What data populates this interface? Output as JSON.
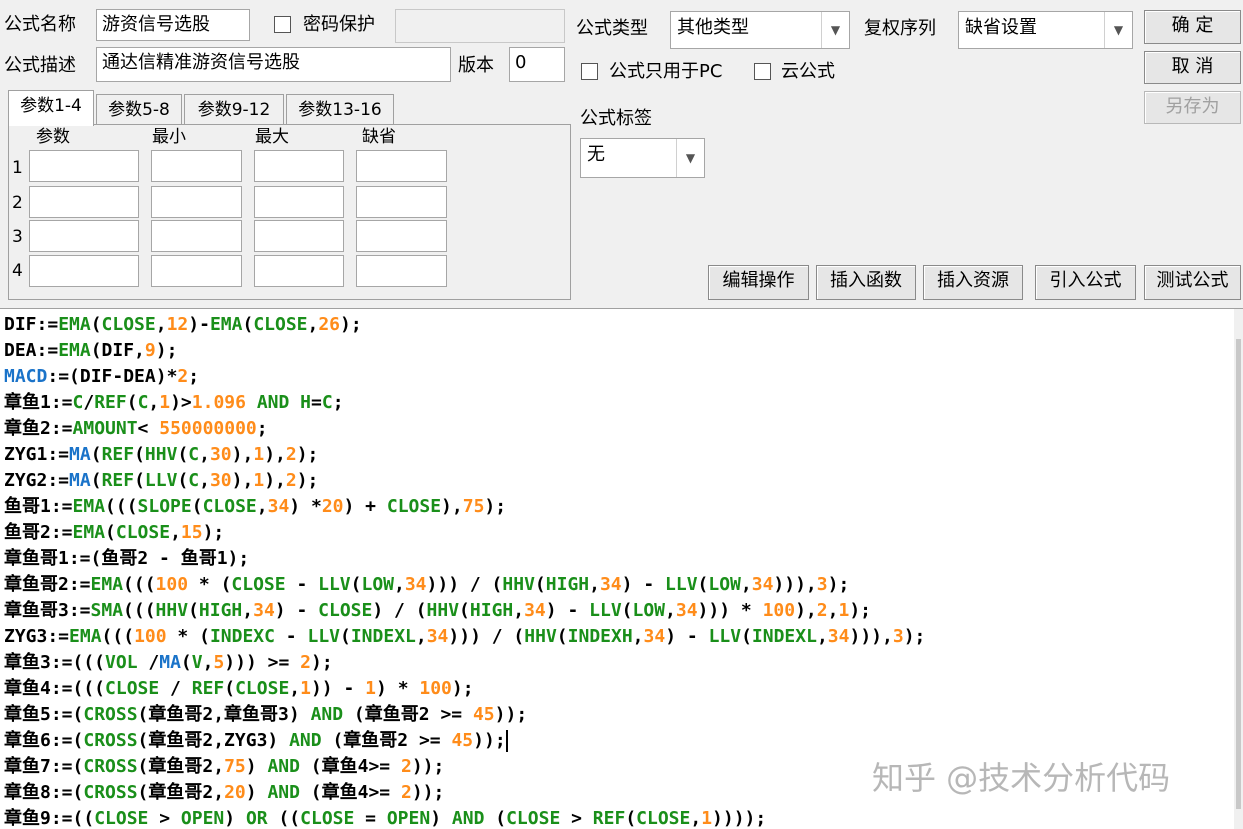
{
  "header": {
    "name_label": "公式名称",
    "name_value": "游资信号选股",
    "password_label": "密码保护",
    "password_checked": false,
    "desc_label": "公式描述",
    "desc_value": "通达信精准游资信号选股",
    "version_label": "版本",
    "version_value": "0",
    "type_label": "公式类型",
    "type_value": "其他类型",
    "rights_label": "复权序列",
    "rights_value": "缺省设置",
    "pc_only_label": "公式只用于PC",
    "cloud_label": "云公式",
    "tag_label": "公式标签",
    "tag_value": "无"
  },
  "buttons": {
    "ok": "确  定",
    "cancel": "取  消",
    "save_as": "另存为",
    "edit_ops": "编辑操作",
    "insert_func": "插入函数",
    "insert_res": "插入资源",
    "import_formula": "引入公式",
    "test_formula": "测试公式"
  },
  "tabs": [
    "参数1-4",
    "参数5-8",
    "参数9-12",
    "参数13-16"
  ],
  "params": {
    "headers": [
      "参数",
      "最小",
      "最大",
      "缺省"
    ],
    "rows": [
      "1",
      "2",
      "3",
      "4"
    ]
  },
  "code_lines": [
    [
      [
        "t",
        "DIF:="
      ],
      [
        "f",
        "EMA"
      ],
      [
        "t",
        "("
      ],
      [
        "f",
        "CLOSE"
      ],
      [
        "t",
        ","
      ],
      [
        "n",
        "12"
      ],
      [
        "t",
        ")-"
      ],
      [
        "f",
        "EMA"
      ],
      [
        "t",
        "("
      ],
      [
        "f",
        "CLOSE"
      ],
      [
        "t",
        ","
      ],
      [
        "n",
        "26"
      ],
      [
        "t",
        ");"
      ]
    ],
    [
      [
        "t",
        "DEA:="
      ],
      [
        "f",
        "EMA"
      ],
      [
        "t",
        "(DIF,"
      ],
      [
        "n",
        "9"
      ],
      [
        "t",
        ");"
      ]
    ],
    [
      [
        "b",
        "MACD"
      ],
      [
        "t",
        ":=(DIF-DEA)*"
      ],
      [
        "n",
        "2"
      ],
      [
        "t",
        ";"
      ]
    ],
    [
      [
        "t",
        "章鱼1:="
      ],
      [
        "f",
        "C"
      ],
      [
        "t",
        "/"
      ],
      [
        "f",
        "REF"
      ],
      [
        "t",
        "("
      ],
      [
        "f",
        "C"
      ],
      [
        "t",
        ","
      ],
      [
        "n",
        "1"
      ],
      [
        "t",
        ")>"
      ],
      [
        "n",
        "1.096"
      ],
      [
        "t",
        " "
      ],
      [
        "f",
        "AND"
      ],
      [
        "t",
        " "
      ],
      [
        "f",
        "H"
      ],
      [
        "t",
        "="
      ],
      [
        "f",
        "C"
      ],
      [
        "t",
        ";"
      ]
    ],
    [
      [
        "t",
        "章鱼2:="
      ],
      [
        "f",
        "AMOUNT"
      ],
      [
        "t",
        "< "
      ],
      [
        "n",
        "550000000"
      ],
      [
        "t",
        ";"
      ]
    ],
    [
      [
        "t",
        "ZYG1:="
      ],
      [
        "b",
        "MA"
      ],
      [
        "t",
        "("
      ],
      [
        "f",
        "REF"
      ],
      [
        "t",
        "("
      ],
      [
        "f",
        "HHV"
      ],
      [
        "t",
        "("
      ],
      [
        "f",
        "C"
      ],
      [
        "t",
        ","
      ],
      [
        "n",
        "30"
      ],
      [
        "t",
        "),"
      ],
      [
        "n",
        "1"
      ],
      [
        "t",
        "),"
      ],
      [
        "n",
        "2"
      ],
      [
        "t",
        ");"
      ]
    ],
    [
      [
        "t",
        "ZYG2:="
      ],
      [
        "b",
        "MA"
      ],
      [
        "t",
        "("
      ],
      [
        "f",
        "REF"
      ],
      [
        "t",
        "("
      ],
      [
        "f",
        "LLV"
      ],
      [
        "t",
        "("
      ],
      [
        "f",
        "C"
      ],
      [
        "t",
        ","
      ],
      [
        "n",
        "30"
      ],
      [
        "t",
        "),"
      ],
      [
        "n",
        "1"
      ],
      [
        "t",
        "),"
      ],
      [
        "n",
        "2"
      ],
      [
        "t",
        ");"
      ]
    ],
    [
      [
        "t",
        "鱼哥1:="
      ],
      [
        "f",
        "EMA"
      ],
      [
        "t",
        "((("
      ],
      [
        "f",
        "SLOPE"
      ],
      [
        "t",
        "("
      ],
      [
        "f",
        "CLOSE"
      ],
      [
        "t",
        ","
      ],
      [
        "n",
        "34"
      ],
      [
        "t",
        ") *"
      ],
      [
        "n",
        "20"
      ],
      [
        "t",
        ") + "
      ],
      [
        "f",
        "CLOSE"
      ],
      [
        "t",
        "),"
      ],
      [
        "n",
        "75"
      ],
      [
        "t",
        ");"
      ]
    ],
    [
      [
        "t",
        "鱼哥2:="
      ],
      [
        "f",
        "EMA"
      ],
      [
        "t",
        "("
      ],
      [
        "f",
        "CLOSE"
      ],
      [
        "t",
        ","
      ],
      [
        "n",
        "15"
      ],
      [
        "t",
        ");"
      ]
    ],
    [
      [
        "t",
        "章鱼哥1:=(鱼哥2 - 鱼哥1);"
      ]
    ],
    [
      [
        "t",
        "章鱼哥2:="
      ],
      [
        "f",
        "EMA"
      ],
      [
        "t",
        "((("
      ],
      [
        "n",
        "100"
      ],
      [
        "t",
        " * ("
      ],
      [
        "f",
        "CLOSE"
      ],
      [
        "t",
        " - "
      ],
      [
        "f",
        "LLV"
      ],
      [
        "t",
        "("
      ],
      [
        "f",
        "LOW"
      ],
      [
        "t",
        ","
      ],
      [
        "n",
        "34"
      ],
      [
        "t",
        ")))"
      ],
      [
        "t",
        " / ("
      ],
      [
        "f",
        "HHV"
      ],
      [
        "t",
        "("
      ],
      [
        "f",
        "HIGH"
      ],
      [
        "t",
        ","
      ],
      [
        "n",
        "34"
      ],
      [
        "t",
        ") - "
      ],
      [
        "f",
        "LLV"
      ],
      [
        "t",
        "("
      ],
      [
        "f",
        "LOW"
      ],
      [
        "t",
        ","
      ],
      [
        "n",
        "34"
      ],
      [
        "t",
        "))),"
      ],
      [
        "n",
        "3"
      ],
      [
        "t",
        ");"
      ]
    ],
    [
      [
        "t",
        "章鱼哥3:="
      ],
      [
        "f",
        "SMA"
      ],
      [
        "t",
        "((("
      ],
      [
        "f",
        "HHV"
      ],
      [
        "t",
        "("
      ],
      [
        "f",
        "HIGH"
      ],
      [
        "t",
        ","
      ],
      [
        "n",
        "34"
      ],
      [
        "t",
        ") - "
      ],
      [
        "f",
        "CLOSE"
      ],
      [
        "t",
        ") / ("
      ],
      [
        "f",
        "HHV"
      ],
      [
        "t",
        "("
      ],
      [
        "f",
        "HIGH"
      ],
      [
        "t",
        ","
      ],
      [
        "n",
        "34"
      ],
      [
        "t",
        ") - "
      ],
      [
        "f",
        "LLV"
      ],
      [
        "t",
        "("
      ],
      [
        "f",
        "LOW"
      ],
      [
        "t",
        ","
      ],
      [
        "n",
        "34"
      ],
      [
        "t",
        ")))"
      ],
      [
        "t",
        " * "
      ],
      [
        "n",
        "100"
      ],
      [
        "t",
        "),"
      ],
      [
        "n",
        "2"
      ],
      [
        "t",
        ","
      ],
      [
        "n",
        "1"
      ],
      [
        "t",
        ");"
      ]
    ],
    [
      [
        "t",
        "ZYG3:="
      ],
      [
        "f",
        "EMA"
      ],
      [
        "t",
        "((("
      ],
      [
        "n",
        "100"
      ],
      [
        "t",
        " * ("
      ],
      [
        "f",
        "INDEXC"
      ],
      [
        "t",
        " - "
      ],
      [
        "f",
        "LLV"
      ],
      [
        "t",
        "("
      ],
      [
        "f",
        "INDEXL"
      ],
      [
        "t",
        ","
      ],
      [
        "n",
        "34"
      ],
      [
        "t",
        ")))"
      ],
      [
        "t",
        " / ("
      ],
      [
        "f",
        "HHV"
      ],
      [
        "t",
        "("
      ],
      [
        "f",
        "INDEXH"
      ],
      [
        "t",
        ","
      ],
      [
        "n",
        "34"
      ],
      [
        "t",
        ") - "
      ],
      [
        "f",
        "LLV"
      ],
      [
        "t",
        "("
      ],
      [
        "f",
        "INDEXL"
      ],
      [
        "t",
        ","
      ],
      [
        "n",
        "34"
      ],
      [
        "t",
        "))),"
      ],
      [
        "n",
        "3"
      ],
      [
        "t",
        ");"
      ]
    ],
    [
      [
        "t",
        "章鱼3:=((("
      ],
      [
        "f",
        "VOL"
      ],
      [
        "t",
        " /"
      ],
      [
        "b",
        "MA"
      ],
      [
        "t",
        "("
      ],
      [
        "f",
        "V"
      ],
      [
        "t",
        ","
      ],
      [
        "n",
        "5"
      ],
      [
        "t",
        ")))"
      ],
      [
        "t",
        " >= "
      ],
      [
        "n",
        "2"
      ],
      [
        "t",
        ");"
      ]
    ],
    [
      [
        "t",
        "章鱼4:=((("
      ],
      [
        "f",
        "CLOSE"
      ],
      [
        "t",
        " / "
      ],
      [
        "f",
        "REF"
      ],
      [
        "t",
        "("
      ],
      [
        "f",
        "CLOSE"
      ],
      [
        "t",
        ","
      ],
      [
        "n",
        "1"
      ],
      [
        "t",
        "))"
      ],
      [
        "t",
        " - "
      ],
      [
        "n",
        "1"
      ],
      [
        "t",
        ") * "
      ],
      [
        "n",
        "100"
      ],
      [
        "t",
        ");"
      ]
    ],
    [
      [
        "t",
        "章鱼5:=("
      ],
      [
        "f",
        "CROSS"
      ],
      [
        "t",
        "(章鱼哥2,章鱼哥3) "
      ],
      [
        "f",
        "AND"
      ],
      [
        "t",
        " (章鱼哥2 >= "
      ],
      [
        "n",
        "45"
      ],
      [
        "t",
        "));"
      ]
    ],
    [
      [
        "t",
        "章鱼6:=("
      ],
      [
        "f",
        "CROSS"
      ],
      [
        "t",
        "(章鱼哥2,ZYG3) "
      ],
      [
        "f",
        "AND"
      ],
      [
        "t",
        " (章鱼哥2 >= "
      ],
      [
        "n",
        "45"
      ],
      [
        "t",
        "));"
      ],
      [
        "c",
        ""
      ]
    ],
    [
      [
        "t",
        "章鱼7:=("
      ],
      [
        "f",
        "CROSS"
      ],
      [
        "t",
        "(章鱼哥2,"
      ],
      [
        "n",
        "75"
      ],
      [
        "t",
        ") "
      ],
      [
        "f",
        "AND"
      ],
      [
        "t",
        " (章鱼4>= "
      ],
      [
        "n",
        "2"
      ],
      [
        "t",
        "));"
      ]
    ],
    [
      [
        "t",
        "章鱼8:=("
      ],
      [
        "f",
        "CROSS"
      ],
      [
        "t",
        "(章鱼哥2,"
      ],
      [
        "n",
        "20"
      ],
      [
        "t",
        ") "
      ],
      [
        "f",
        "AND"
      ],
      [
        "t",
        " (章鱼4>= "
      ],
      [
        "n",
        "2"
      ],
      [
        "t",
        "));"
      ]
    ],
    [
      [
        "t",
        "章鱼9:=(("
      ],
      [
        "f",
        "CLOSE"
      ],
      [
        "t",
        " > "
      ],
      [
        "f",
        "OPEN"
      ],
      [
        "t",
        ") "
      ],
      [
        "f",
        "OR"
      ],
      [
        "t",
        " (("
      ],
      [
        "f",
        "CLOSE"
      ],
      [
        "t",
        " = "
      ],
      [
        "f",
        "OPEN"
      ],
      [
        "t",
        ") "
      ],
      [
        "f",
        "AND"
      ],
      [
        "t",
        " ("
      ],
      [
        "f",
        "CLOSE"
      ],
      [
        "t",
        " > "
      ],
      [
        "f",
        "REF"
      ],
      [
        "t",
        "("
      ],
      [
        "f",
        "CLOSE"
      ],
      [
        "t",
        ","
      ],
      [
        "n",
        "1"
      ],
      [
        "t",
        "))));"
      ]
    ]
  ],
  "watermark": "知乎 @技术分析代码",
  "colors": {
    "function": "#1a8f1a",
    "number": "#ff8c1a",
    "builtin_blue": "#1a73c9",
    "text": "#000000"
  }
}
